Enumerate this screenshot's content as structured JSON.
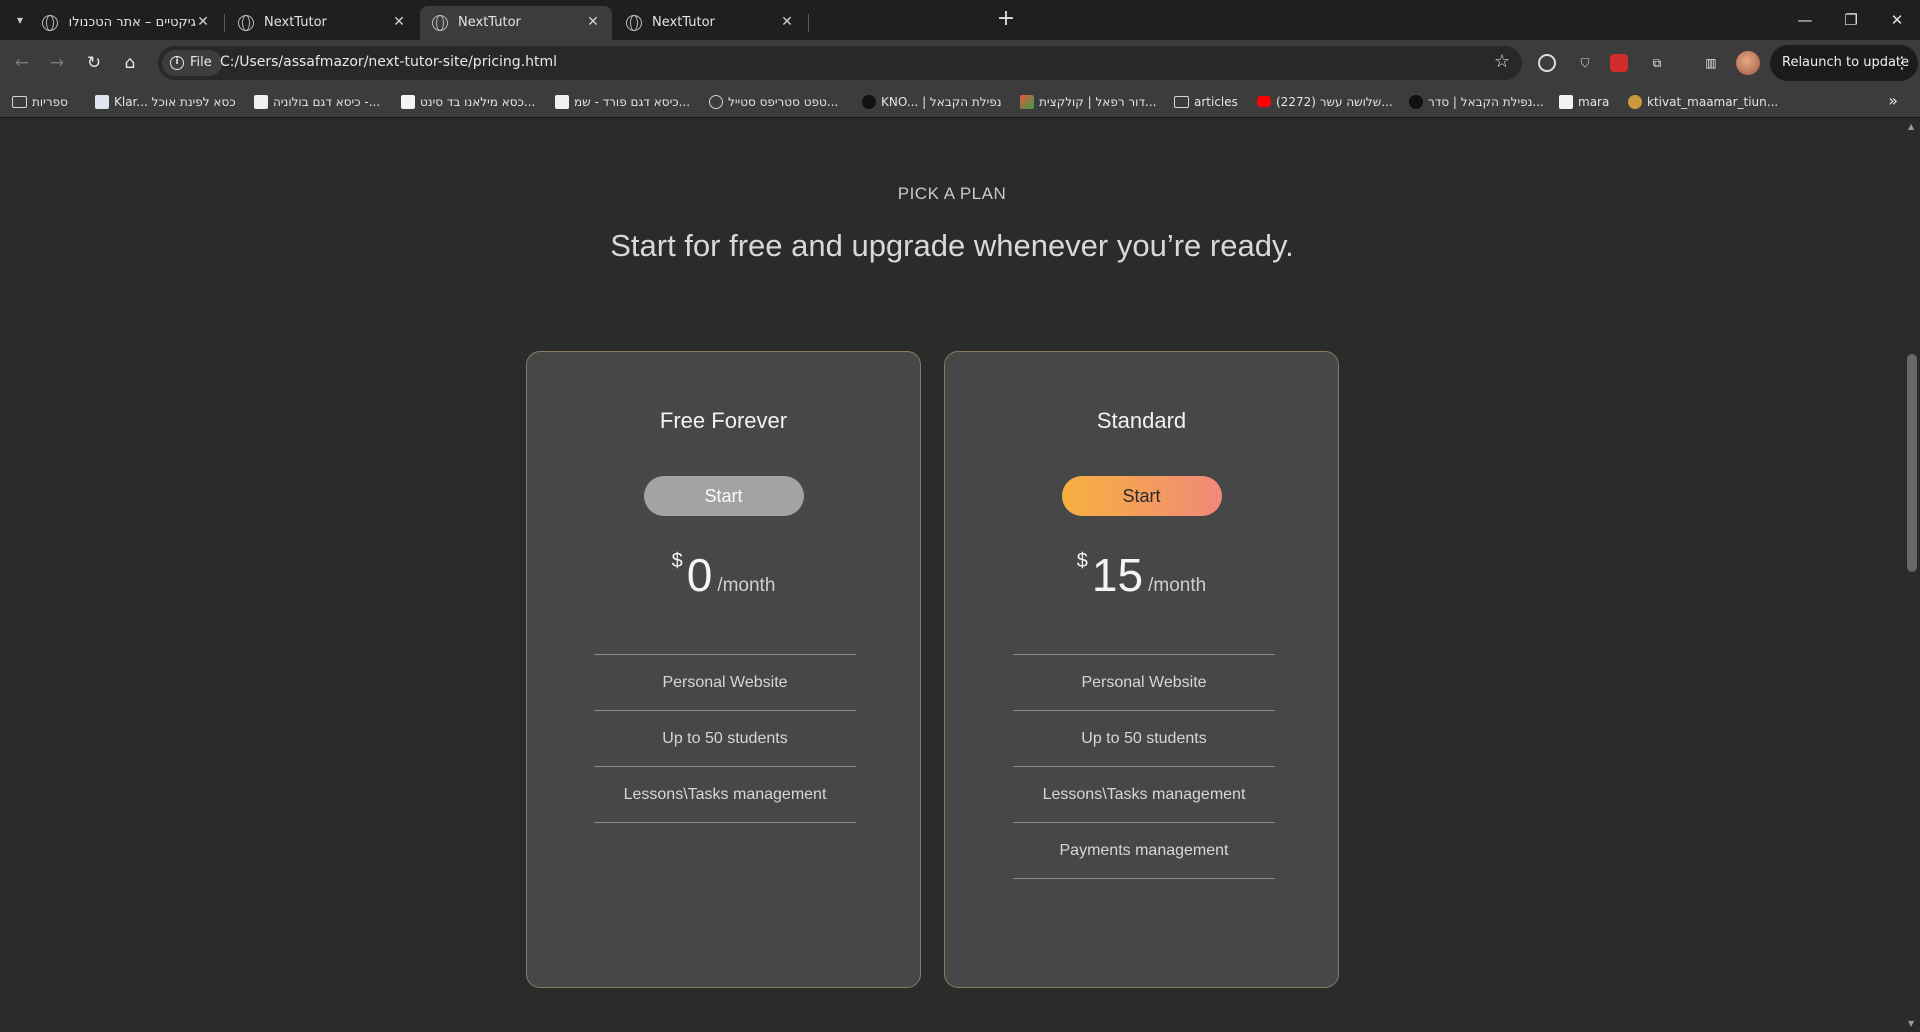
{
  "browser": {
    "tabs": [
      {
        "title": "גיקטיים – אתר הטכנולוגיה וההי",
        "active": false
      },
      {
        "title": "NextTutor",
        "active": false
      },
      {
        "title": "NextTutor",
        "active": true
      },
      {
        "title": "NextTutor",
        "active": false
      }
    ],
    "omnibox": {
      "chip_label": "File",
      "url": "C:/Users/assafmazor/next-tutor-site/pricing.html"
    },
    "relaunch_label": "Relaunch to update",
    "bookmarks": [
      {
        "label": "ספריות",
        "icon": "folder-icon"
      },
      {
        "label": "Klar... כסא לפינת אוכל",
        "icon": "site-icon"
      },
      {
        "label": "כיסא דגם בולוניה -...",
        "icon": "site-icon"
      },
      {
        "label": "כסא מילאנו בד סינט...",
        "icon": "site-icon"
      },
      {
        "label": "כיסא דגם פורד - שמ...",
        "icon": "site-icon"
      },
      {
        "label": "טפט סטריפס סטייל...",
        "icon": "globe-icon"
      },
      {
        "label": "KNO... | נפילת הקבאל",
        "icon": "site-icon"
      },
      {
        "label": "דור רפאל | קולקצית...",
        "icon": "site-icon"
      },
      {
        "label": "articles",
        "icon": "folder-icon"
      },
      {
        "label": "(2272) שלושה עשר...",
        "icon": "youtube-icon"
      },
      {
        "label": "נפילת הקבאל | סדר...",
        "icon": "site-icon"
      },
      {
        "label": "mara",
        "icon": "site-icon"
      },
      {
        "label": "ktivat_maamar_tiun...",
        "icon": "site-icon"
      }
    ]
  },
  "hero": {
    "eyebrow": "PICK A PLAN",
    "headline": "Start for free and upgrade whenever you’re ready."
  },
  "plans": [
    {
      "name": "Free Forever",
      "button": "Start",
      "currency": "$",
      "price": "0",
      "period": "/month",
      "features": [
        "Personal Website",
        "Up to 50 students",
        "Lessons\\Tasks management"
      ]
    },
    {
      "name": "Standard",
      "button": "Start",
      "currency": "$",
      "price": "15",
      "period": "/month",
      "features": [
        "Personal Website",
        "Up to 50 students",
        "Lessons\\Tasks management",
        "Payments management"
      ]
    }
  ],
  "colors": {
    "page_bg": "#2b2b2b",
    "card_bg": "#474747",
    "card_border": "#8a7a5e",
    "free_button": "#a3a3a3",
    "standard_button_gradient": [
      "#f7b13e",
      "#f08978"
    ]
  }
}
